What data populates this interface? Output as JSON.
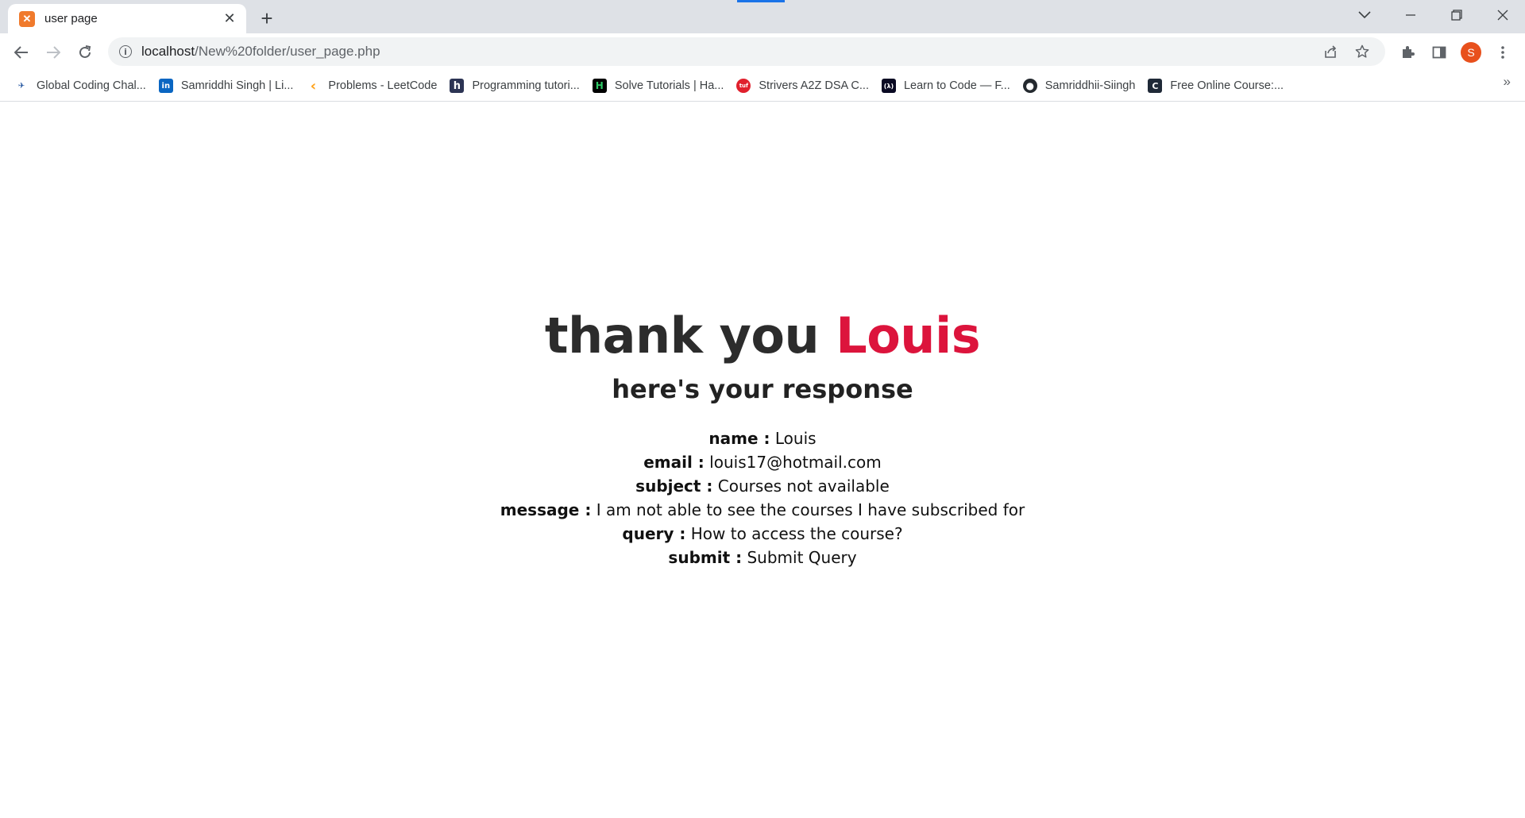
{
  "tab": {
    "favicon": "xampp-icon",
    "title": "user page"
  },
  "window_controls": {
    "tab_search_icon": "chevron-down-icon",
    "minimize_icon": "minimize-icon",
    "restore_icon": "restore-icon",
    "close_icon": "close-icon"
  },
  "toolbar": {
    "url_host": "localhost",
    "url_path": "/New%20folder/user_page.php",
    "avatar_letter": "S",
    "avatar_color": "#e8501c"
  },
  "bookmarks": [
    {
      "label": "Global Coding Chal...",
      "icon": "codechef-icon",
      "color": "#1b4f9c",
      "glyph": "✈"
    },
    {
      "label": "Samriddhi Singh | Li...",
      "icon": "linkedin-icon",
      "color": "#0a66c2",
      "glyph": "in"
    },
    {
      "label": "Problems - LeetCode",
      "icon": "leetcode-icon",
      "color": "#ffa116",
      "glyph": "‹"
    },
    {
      "label": "Programming tutori...",
      "icon": "hackerearth-icon",
      "color": "#2c3454",
      "glyph": "h"
    },
    {
      "label": "Solve Tutorials | Ha...",
      "icon": "hackerrank-icon",
      "color": "#000000",
      "glyph": "H"
    },
    {
      "label": "Strivers A2Z DSA C...",
      "icon": "takeuforward-icon",
      "color": "#e0202d",
      "glyph": "tuf"
    },
    {
      "label": "Learn to Code — F...",
      "icon": "freecodecamp-icon",
      "color": "#0a0a23",
      "glyph": "(λ)"
    },
    {
      "label": "Samriddhii-Siingh",
      "icon": "github-icon",
      "color": "#24292f",
      "glyph": "●"
    },
    {
      "label": "Free Online Course:...",
      "icon": "codecademy-icon",
      "color": "#1f2937",
      "glyph": "C"
    }
  ],
  "page": {
    "heading_prefix": "thank you",
    "user_name": "Louis",
    "subheading": "here's your response",
    "accent_color": "#dc143c",
    "fields": [
      {
        "label": "name :",
        "value": "Louis"
      },
      {
        "label": "email :",
        "value": "louis17@hotmail.com"
      },
      {
        "label": "subject :",
        "value": "Courses not available"
      },
      {
        "label": "message :",
        "value": "I am not able to see the courses I have subscribed for"
      },
      {
        "label": "query :",
        "value": "How to access the course?"
      },
      {
        "label": "submit :",
        "value": "Submit Query"
      }
    ]
  }
}
